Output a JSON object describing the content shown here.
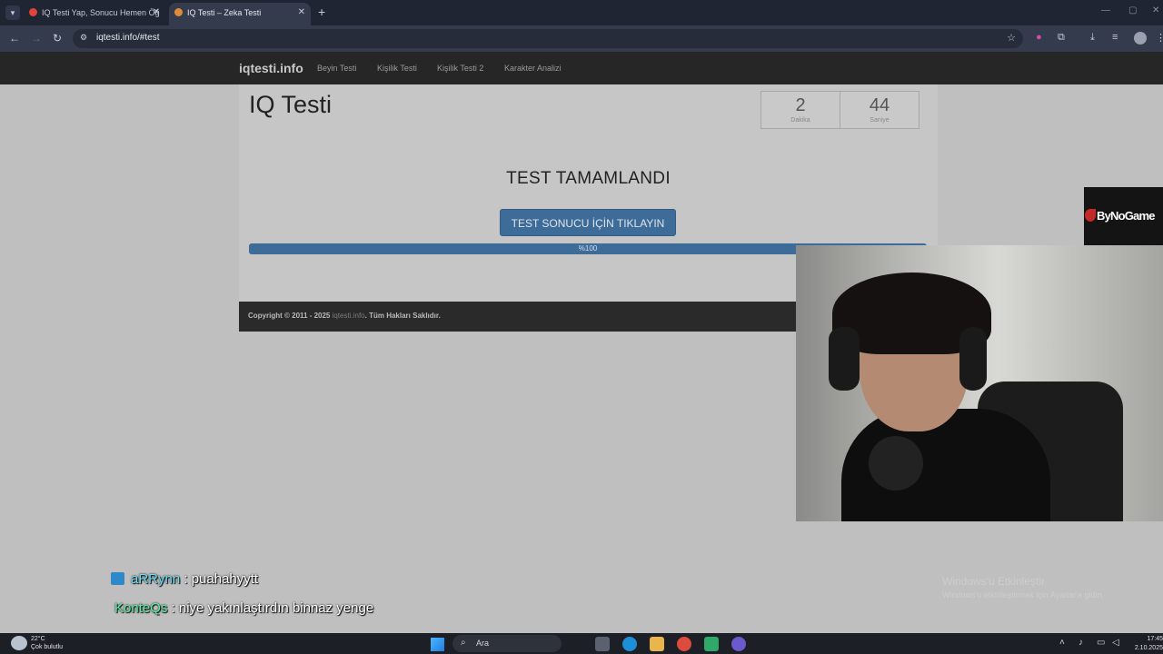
{
  "browser": {
    "tabs": [
      {
        "title": "IQ Testi Yap, Sonucu Hemen Öğ",
        "active": false,
        "favicon_color": "#e0443c"
      },
      {
        "title": "IQ Testi – Zeka Testi",
        "active": true,
        "favicon_color": "#e08a3c"
      }
    ],
    "url": "iqtesti.info/#test"
  },
  "site": {
    "brand": "iqtesti.info",
    "nav": [
      "Beyin Testi",
      "Kişilik Testi",
      "Kişilik Testi 2",
      "Karakter Analizi"
    ],
    "page_title": "IQ Testi",
    "timer": {
      "minutes": "2",
      "minutes_label": "Dakika",
      "seconds": "44",
      "seconds_label": "Saniye"
    },
    "status_heading": "TEST TAMAMLANDI",
    "result_button": "TEST SONUCU İÇİN TIKLAYIN",
    "progress": {
      "label": "%100",
      "value": 1.0
    },
    "footer": {
      "prefix": "Copyright © 2011 - 2025 ",
      "link": "iqtesti.info",
      "suffix": ". Tüm Hakları Saklıdır."
    }
  },
  "overlay": {
    "logo_text": "ByNoGame"
  },
  "chat": [
    {
      "user": "aRRynn",
      "message": " : puahahyytt"
    },
    {
      "user": "KonteQs",
      "message": " : niye yakınlaştırdın binnaz yenge"
    }
  ],
  "watermark": {
    "line1": "Windows'u Etkinleştir",
    "line2": "Windows'u etkinleştirmek için Ayarlar'a gidin."
  },
  "taskbar": {
    "weather_temp": "22°C",
    "weather_desc": "Çok bulutlu",
    "search_label": "Ara",
    "time": "17:45",
    "date": "2.10.2025"
  },
  "colors": {
    "accent": "#3e6c98",
    "navbar": "#262626",
    "footer": "#2a2a2a",
    "chat_user1": "#6fd9ee",
    "chat_user2": "#5eeaa5"
  }
}
